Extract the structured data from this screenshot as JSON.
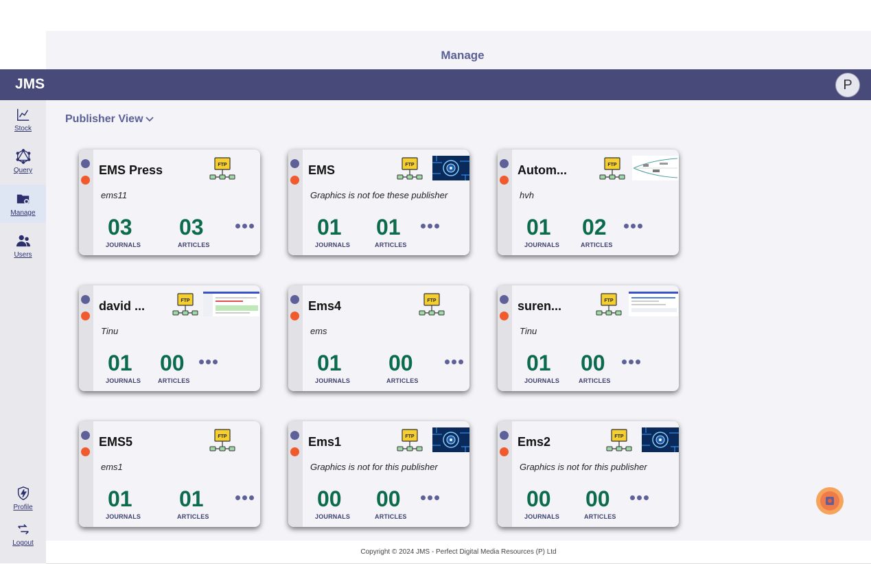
{
  "header": {
    "section_title": "Manage",
    "brand": "JMS",
    "avatar_initial": "P"
  },
  "sidebar": {
    "items": [
      {
        "label": "Stock",
        "icon": "chart-icon"
      },
      {
        "label": "Query",
        "icon": "graphql-icon"
      },
      {
        "label": "Manage",
        "icon": "folder-gear-icon"
      },
      {
        "label": "Users",
        "icon": "users-icon"
      }
    ],
    "bottom": [
      {
        "label": "Profile",
        "icon": "shield-bolt-icon"
      },
      {
        "label": "Logout",
        "icon": "logout-icon"
      }
    ]
  },
  "main": {
    "view_label": "Publisher View"
  },
  "cards": [
    {
      "title": "EMS Press",
      "subtitle": "ems11",
      "journals": "03",
      "articles": "03",
      "journals_label": "JOURNALS",
      "articles_label": "ARTICLES",
      "thumb": "none"
    },
    {
      "title": "EMS",
      "subtitle": "Graphics is not foe these publisher",
      "journals": "01",
      "articles": "01",
      "journals_label": "JOURNALS",
      "articles_label": "ARTICLES",
      "thumb": "tech"
    },
    {
      "title": "Autom...",
      "subtitle": "hvh",
      "journals": "01",
      "articles": "02",
      "journals_label": "JOURNALS",
      "articles_label": "ARTICLES",
      "thumb": "diagram"
    },
    {
      "title": "david ...",
      "subtitle": "Tinu",
      "journals": "01",
      "articles": "00",
      "journals_label": "JOURNALS",
      "articles_label": "ARTICLES",
      "thumb": "screenshot"
    },
    {
      "title": "Ems4",
      "subtitle": "ems",
      "journals": "01",
      "articles": "00",
      "journals_label": "JOURNALS",
      "articles_label": "ARTICLES",
      "thumb": "none"
    },
    {
      "title": "suren...",
      "subtitle": "Tinu",
      "journals": "01",
      "articles": "00",
      "journals_label": "JOURNALS",
      "articles_label": "ARTICLES",
      "thumb": "screenshot2"
    },
    {
      "title": "EMS5",
      "subtitle": "ems1",
      "journals": "01",
      "articles": "01",
      "journals_label": "JOURNALS",
      "articles_label": "ARTICLES",
      "thumb": "none"
    },
    {
      "title": "Ems1",
      "subtitle": "Graphics is not for this publisher",
      "journals": "00",
      "articles": "00",
      "journals_label": "JOURNALS",
      "articles_label": "ARTICLES",
      "thumb": "tech"
    },
    {
      "title": "Ems2",
      "subtitle": "Graphics is not for this publisher",
      "journals": "00",
      "articles": "00",
      "journals_label": "JOURNALS",
      "articles_label": "ARTICLES",
      "thumb": "tech"
    }
  ],
  "ftp_label": "FTP",
  "footer": {
    "copyright": "Copyright © 2024 JMS - Perfect Digital Media Resources (P) Ltd"
  },
  "colors": {
    "brand_bar": "#484b79",
    "count_green": "#0b6b4b",
    "accent_purple": "#5e6199",
    "accent_orange": "#f05a2c"
  }
}
